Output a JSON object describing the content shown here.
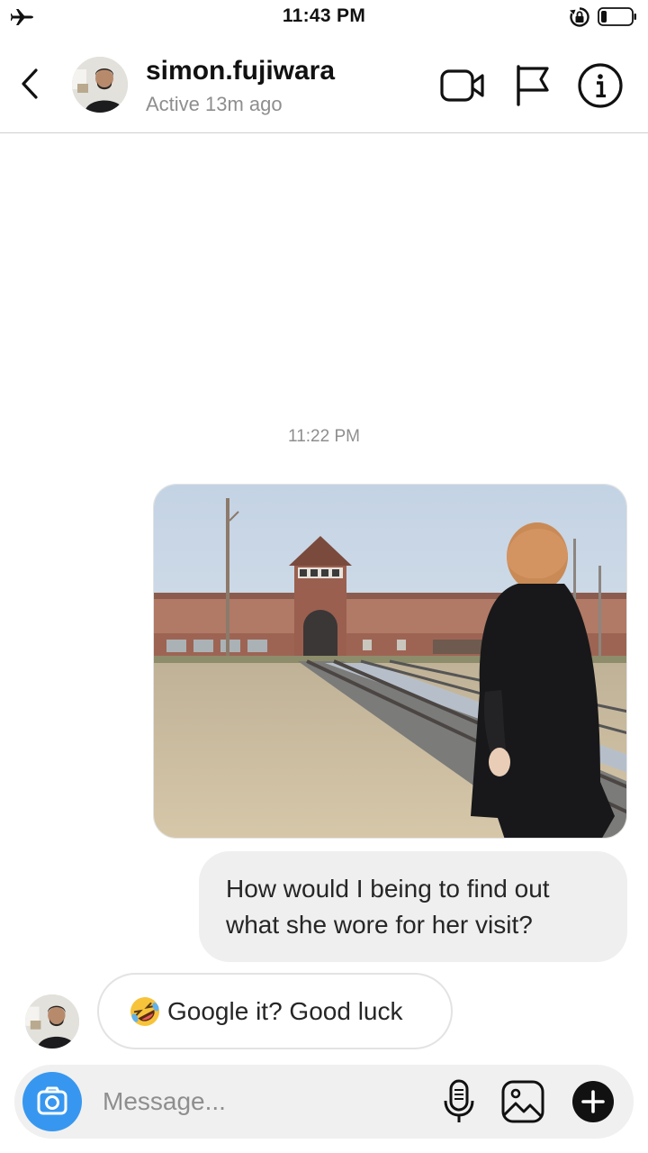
{
  "status_bar": {
    "time": "11:43 PM",
    "icons": [
      "airplane-icon",
      "rotation-lock-icon",
      "battery-icon"
    ]
  },
  "header": {
    "username": "simon.fujiwara",
    "status": "Active 13m ago",
    "icons": [
      "back-icon",
      "avatar",
      "video-call-icon",
      "flag-icon",
      "info-icon"
    ]
  },
  "chat": {
    "timestamp": "11:22 PM",
    "sent_photo": "photo",
    "sent_message": "How would I being to find out what she wore for her visit?",
    "received_message": "Google it? Good luck",
    "received_emoji": "rolling-on-floor-laughing-icon"
  },
  "composer": {
    "placeholder": "Message...",
    "value": "",
    "icons": [
      "camera-icon",
      "microphone-icon",
      "gallery-icon",
      "plus-icon"
    ]
  },
  "colors": {
    "accent": "#3797f0",
    "bubble_gray": "#efefef",
    "secondary_text": "#8e8e8e"
  }
}
